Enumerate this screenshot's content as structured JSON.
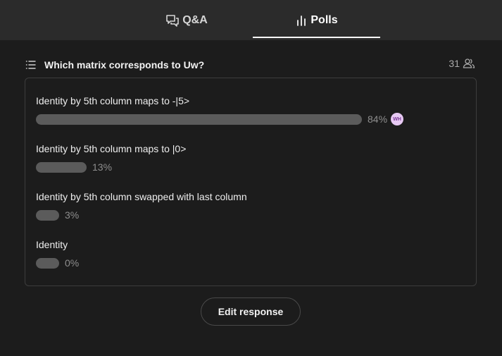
{
  "tabs": {
    "qa": {
      "label": "Q&A",
      "icon": "chat-bubbles-icon"
    },
    "polls": {
      "label": "Polls",
      "icon": "bar-chart-icon",
      "active": true
    }
  },
  "poll": {
    "question": "Which matrix corresponds to Uw?",
    "respondents": "31",
    "options": [
      {
        "label": "Identity by 5th column maps to -|5>",
        "percent_text": "84%",
        "value": 0.84,
        "voter_initials": "WH"
      },
      {
        "label": "Identity by 5th column maps to |0>",
        "percent_text": "13%",
        "value": 0.13
      },
      {
        "label": "Identity by 5th column swapped with last column",
        "percent_text": "3%",
        "value": 0.03
      },
      {
        "label": "Identity",
        "percent_text": "0%",
        "value": 0.0
      }
    ]
  },
  "actions": {
    "edit_response": "Edit response"
  },
  "colors": {
    "background": "#1c1c1c",
    "tabbar": "#2b2b2b",
    "bar": "#5b5b5b",
    "avatar_bg": "#e7c9f3",
    "avatar_text": "#7b3a96"
  }
}
